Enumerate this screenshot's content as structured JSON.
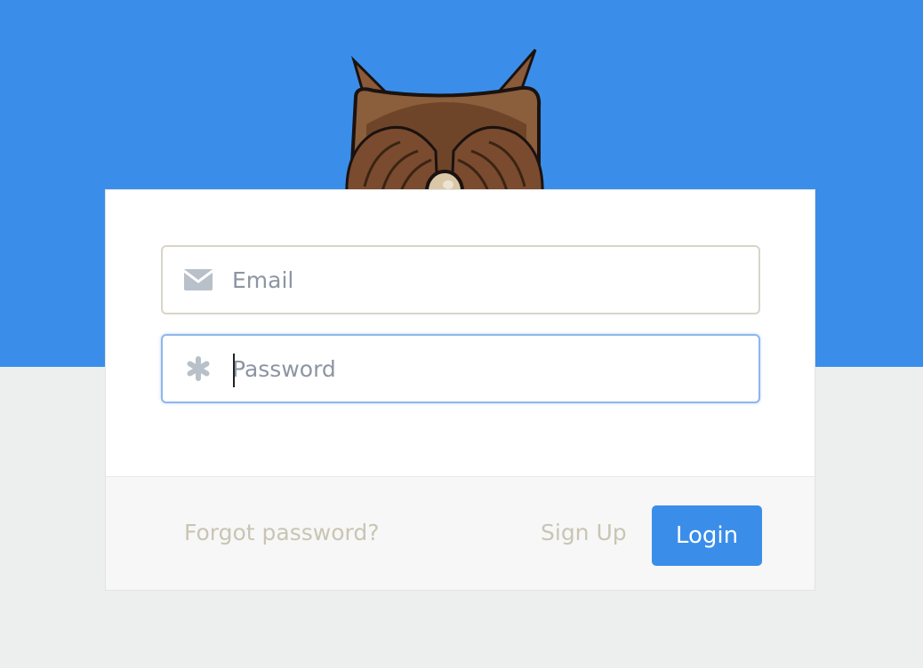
{
  "colors": {
    "header_blue": "#3a8eea",
    "page_background": "#edeeee",
    "card_background": "#ffffff",
    "footer_background": "#f7f7f7",
    "link_muted": "#c9c5b4",
    "button_blue": "#3a8eea",
    "focus_border": "#8fb6ec"
  },
  "illustration": {
    "icon": "owl-covering-eyes-icon"
  },
  "form": {
    "email": {
      "icon": "envelope-icon",
      "placeholder": "Email",
      "value": ""
    },
    "password": {
      "icon": "asterisk-icon",
      "placeholder": "Password",
      "value": "",
      "focused": true
    }
  },
  "footer": {
    "forgot_label": "Forgot password?",
    "signup_label": "Sign Up",
    "login_label": "Login"
  }
}
